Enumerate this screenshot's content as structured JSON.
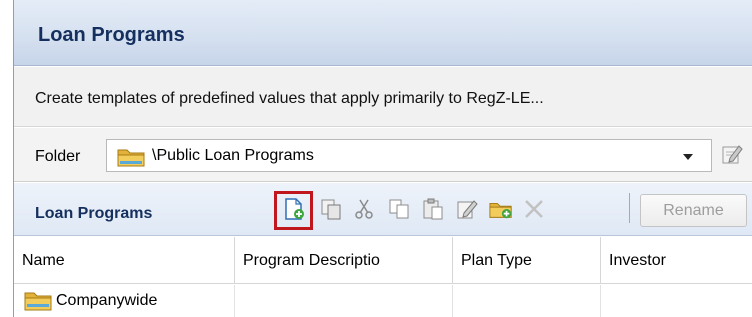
{
  "header": {
    "title": "Loan Programs"
  },
  "description": "Create templates of predefined values that apply primarily to RegZ-LE...",
  "folder": {
    "label": "Folder",
    "selected": "\\Public Loan Programs",
    "icon": "folder-icon"
  },
  "toolbar": {
    "title": "Loan Programs",
    "buttons": [
      {
        "name": "new-icon",
        "tooltip": ""
      },
      {
        "name": "duplicate-icon"
      },
      {
        "name": "cut-icon"
      },
      {
        "name": "copy-icon"
      },
      {
        "name": "paste-icon"
      },
      {
        "name": "edit-icon"
      },
      {
        "name": "new-folder-icon"
      },
      {
        "name": "delete-icon"
      }
    ],
    "rename_label": "Rename",
    "highlight_color": "#c0161d"
  },
  "table": {
    "columns": [
      "Name",
      "Program Descriptio",
      "Plan Type",
      "Investor"
    ],
    "rows": [
      {
        "name": "Companywide",
        "icon": "folder-icon",
        "description": "",
        "plan_type": "",
        "investor": ""
      }
    ]
  },
  "colors": {
    "title_text": "#15305e",
    "accent_border": "#8a9fbd"
  }
}
